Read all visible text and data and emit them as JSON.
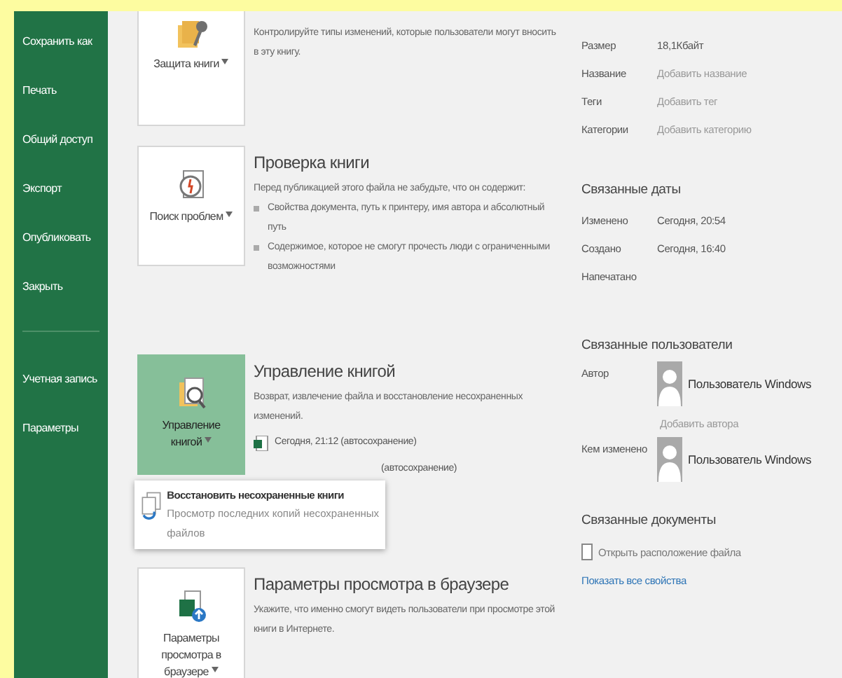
{
  "sidebar": {
    "items": [
      {
        "label": "Сохранить как"
      },
      {
        "label": "Печать"
      },
      {
        "label": "Общий доступ"
      },
      {
        "label": "Экспорт"
      },
      {
        "label": "Опубликовать"
      },
      {
        "label": "Закрыть"
      }
    ],
    "footer_items": [
      {
        "label": "Учетная запись"
      },
      {
        "label": "Параметры"
      }
    ]
  },
  "sections": [
    {
      "kind": "protect",
      "button": {
        "label": "Защита книги",
        "selected": false
      },
      "description": "Контролируйте типы изменений, которые пользователи могут вносить в эту книгу."
    },
    {
      "kind": "inspect",
      "button": {
        "label": "Поиск проблем",
        "selected": false
      },
      "title": "Проверка книги",
      "description": "Перед публикацией этого файла не забудьте, что он содержит:",
      "bullets": [
        "Свойства документа, путь к принтеру, имя автора и абсолютный путь",
        "Содержимое, которое не смогут прочесть люди с ограниченными возможностями"
      ]
    },
    {
      "kind": "manage",
      "button": {
        "label": "Управление книгой",
        "selected": true
      },
      "title": "Управление книгой",
      "description": "Возврат, извлечение файла и восстановление несохраненных изменений.",
      "versions": [
        {
          "kind": "file",
          "text": "Сегодня, 21:12 (автосохранение)"
        },
        {
          "kind": "covered",
          "text": "(автосохранение)"
        }
      ],
      "menu": {
        "items": [
          {
            "title": "Восстановить несохраненные книги",
            "description": "Просмотр последних копий несохраненных файлов"
          }
        ]
      }
    },
    {
      "kind": "browser",
      "button": {
        "label": "Параметры просмотра в браузере",
        "selected": false
      },
      "title": "Параметры просмотра в браузере",
      "description": "Укажите, что именно смогут видеть пользователи при просмотре этой книги в Интернете."
    }
  ],
  "properties": {
    "rows": [
      {
        "label": "Размер",
        "value": "18,1Кбайт",
        "kind": "value"
      },
      {
        "label": "Название",
        "value": "Добавить название",
        "kind": "placeholder"
      },
      {
        "label": "Теги",
        "value": "Добавить тег",
        "kind": "placeholder"
      },
      {
        "label": "Категории",
        "value": "Добавить категорию",
        "kind": "placeholder"
      }
    ]
  },
  "related_dates": {
    "title": "Связанные даты",
    "rows": [
      {
        "label": "Изменено",
        "value": "Сегодня, 20:54",
        "kind": "value"
      },
      {
        "label": "Создано",
        "value": "Сегодня, 16:40",
        "kind": "value"
      },
      {
        "label": "Напечатано"
      }
    ]
  },
  "related_people": {
    "title": "Связанные пользователи",
    "rows": [
      {
        "label": "Автор",
        "person": "Пользователь Windows",
        "add_link": "Добавить автора"
      },
      {
        "label": "Кем изменено",
        "person": "Пользователь Windows"
      }
    ]
  },
  "related_documents": {
    "title": "Связанные документы",
    "open_location": "Открыть расположение файла",
    "show_all": "Показать все свойства"
  }
}
